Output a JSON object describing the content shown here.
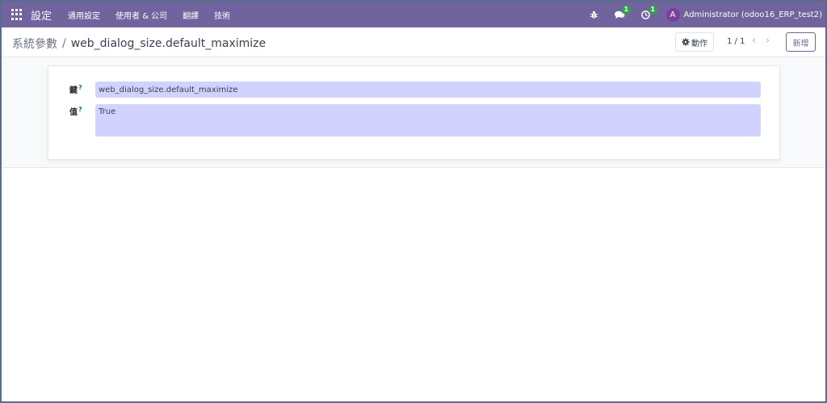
{
  "navbar": {
    "app_title": "設定",
    "menu": [
      "通用設定",
      "使用者 & 公司",
      "翻譯",
      "技術"
    ],
    "messages_count": "1",
    "activities_count": "1",
    "user_initial": "A",
    "user_name": "Administrator (odoo16_ERP_test2)"
  },
  "breadcrumb": {
    "parent": "系統參數",
    "separator": "/",
    "current": "web_dialog_size.default_maximize"
  },
  "control": {
    "action_label": "動作",
    "pager": "1 / 1",
    "new_label": "新增"
  },
  "form": {
    "key_label": "鍵",
    "key_help": "?",
    "key_value": "web_dialog_size.default_maximize",
    "value_label": "值",
    "value_help": "?",
    "value_value": "True"
  },
  "colors": {
    "navbar": "#71639e",
    "input_bg": "#d2d2ff",
    "badge": "#28a745",
    "avatar": "#7b3fa0"
  },
  "icons": {
    "apps": "apps-grid-icon",
    "debug": "bug-icon",
    "messages": "comments-icon",
    "activities": "clock-icon",
    "action": "gear-icon",
    "prev": "chevron-left-icon",
    "next": "chevron-right-icon"
  }
}
